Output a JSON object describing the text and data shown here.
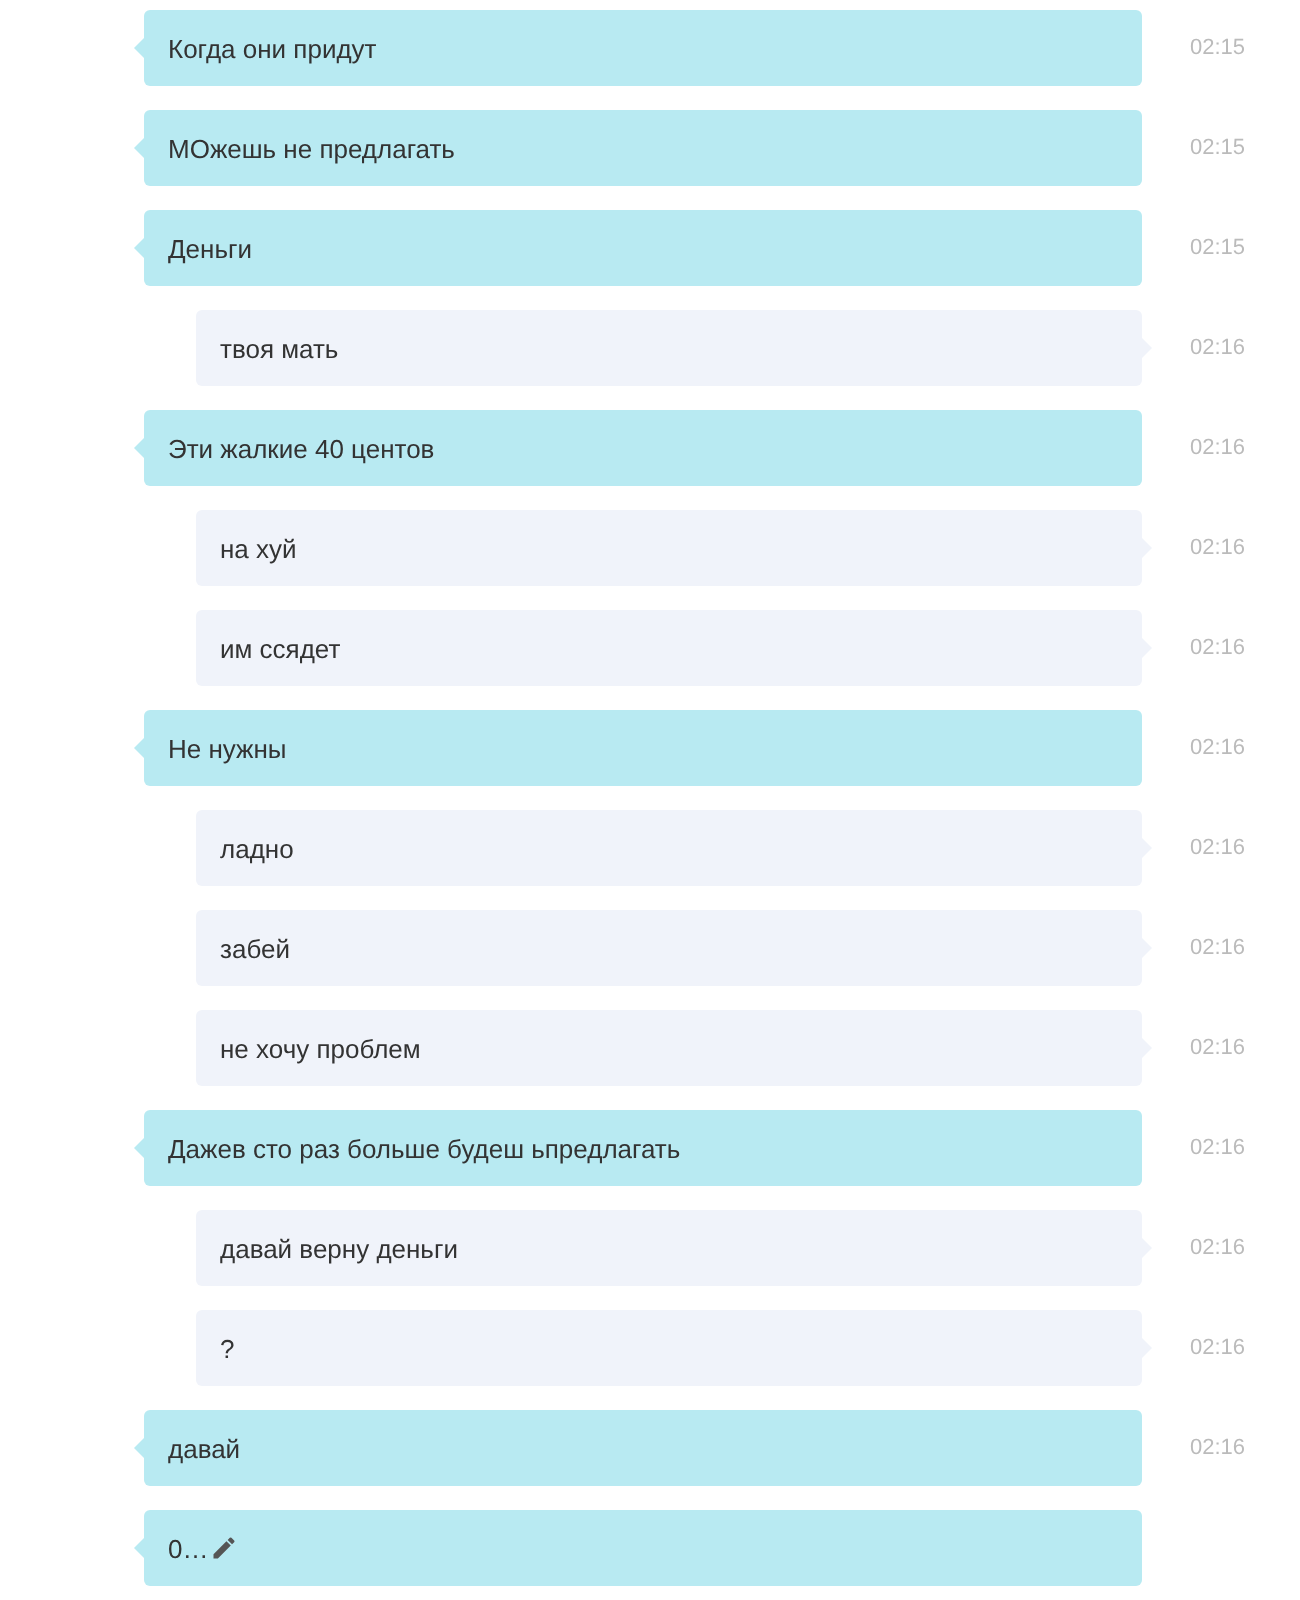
{
  "messages": [
    {
      "kind": "incoming",
      "text": "Когда они придут",
      "time": "02:15"
    },
    {
      "kind": "incoming",
      "text": "МОжешь не предлагать",
      "time": "02:15"
    },
    {
      "kind": "incoming",
      "text": "Деньги",
      "time": "02:15"
    },
    {
      "kind": "outgoing",
      "text": "твоя мать",
      "time": "02:16"
    },
    {
      "kind": "incoming",
      "text": "Эти жалкие 40 центов",
      "time": "02:16"
    },
    {
      "kind": "outgoing",
      "text": "на хуй",
      "time": "02:16"
    },
    {
      "kind": "outgoing",
      "text": "им ссядет",
      "time": "02:16"
    },
    {
      "kind": "incoming",
      "text": "Не нужны",
      "time": "02:16"
    },
    {
      "kind": "outgoing",
      "text": "ладно",
      "time": "02:16"
    },
    {
      "kind": "outgoing",
      "text": "забей",
      "time": "02:16"
    },
    {
      "kind": "outgoing",
      "text": "не хочу проблем",
      "time": "02:16"
    },
    {
      "kind": "incoming",
      "text": "Дажев сто раз больше будеш ьпредлагать",
      "time": "02:16"
    },
    {
      "kind": "outgoing",
      "text": "давай верну деньги",
      "time": "02:16"
    },
    {
      "kind": "outgoing",
      "text": "?",
      "time": "02:16"
    },
    {
      "kind": "incoming",
      "text": "давай",
      "time": "02:16"
    },
    {
      "kind": "incoming",
      "text": "0…",
      "typing": true
    }
  ]
}
